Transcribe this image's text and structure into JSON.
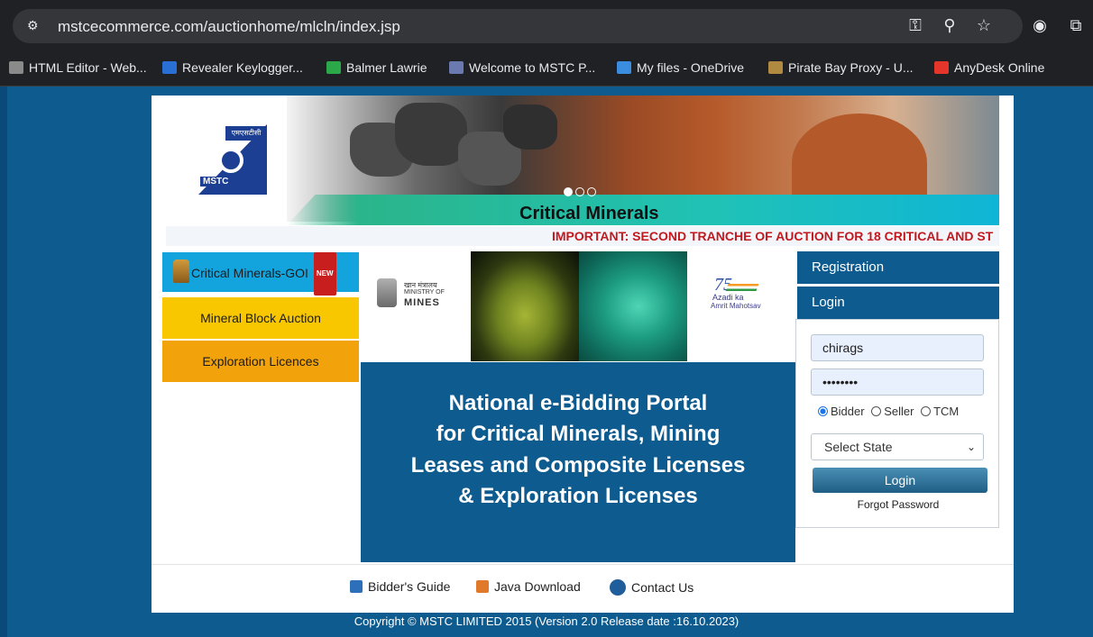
{
  "browser": {
    "url": "mstcecommerce.com/auctionhome/mlcln/index.jsp",
    "bookmarks": [
      {
        "label": "HTML Editor - Web...",
        "color": "#8a8a8a"
      },
      {
        "label": "Revealer Keylogger...",
        "color": "#2a6fd6"
      },
      {
        "label": "Balmer Lawrie",
        "color": "#2aa84a"
      },
      {
        "label": "Welcome to MSTC P...",
        "color": "#6a7ab0"
      },
      {
        "label": "My files - OneDrive",
        "color": "#3b8de0"
      },
      {
        "label": "Pirate Bay Proxy - U...",
        "color": "#b08a40"
      },
      {
        "label": "AnyDesk Online",
        "color": "#e3352a"
      }
    ]
  },
  "logo": {
    "hindi": "एमएसटीसी",
    "text": "MSTC"
  },
  "banner": {
    "title": "Critical Minerals"
  },
  "ticker": "IMPORTANT: SECOND TRANCHE OF AUCTION FOR 18 CRITICAL AND ST",
  "menu": {
    "critical": "Critical Minerals-GOI",
    "new_badge": "NEW",
    "mineral_block": "Mineral Block Auction",
    "exploration": "Exploration Licences"
  },
  "mines": {
    "hindi": "खान मंत्रालय",
    "line1": "MINISTRY OF",
    "line2": "MINES"
  },
  "azadi": {
    "num": "75",
    "line1": "Azadi ka",
    "line2": "Amrit Mahotsav"
  },
  "portal": {
    "lines": [
      "National e-Bidding Portal",
      "for Critical Minerals, Mining",
      "Leases and Composite Licenses",
      "& Exploration Licenses"
    ]
  },
  "sidebar": {
    "registration": "Registration",
    "login": "Login"
  },
  "login": {
    "username": "chirags",
    "password": "••••••••",
    "roles": [
      "Bidder",
      "Seller",
      "TCM"
    ],
    "state_placeholder": "Select State",
    "button": "Login",
    "forgot": "Forgot Password"
  },
  "footer": {
    "bidders_guide": "Bidder's Guide",
    "java": "Java Download",
    "contact": "Contact Us",
    "copyright": "Copyright © MSTC LIMITED 2015 (Version 2.0 Release date :16.10.2023)"
  }
}
